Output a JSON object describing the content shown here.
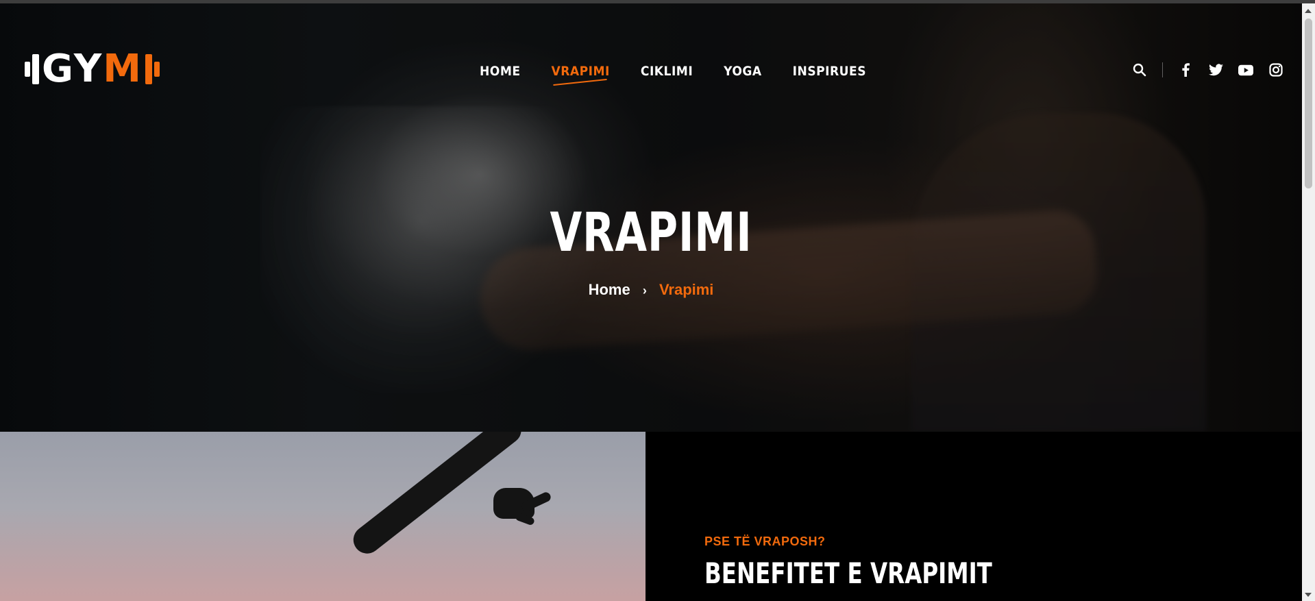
{
  "brand": {
    "logo_prefix": "GY",
    "logo_accent": "M",
    "accent_color": "#f26a0d"
  },
  "nav": {
    "items": [
      {
        "label": "HOME",
        "active": false
      },
      {
        "label": "VRAPIMI",
        "active": true
      },
      {
        "label": "CIKLIMI",
        "active": false
      },
      {
        "label": "YOGA",
        "active": false
      },
      {
        "label": "INSPIRUES",
        "active": false
      }
    ]
  },
  "header_icons": [
    "search-icon",
    "facebook-icon",
    "twitter-icon",
    "youtube-icon",
    "instagram-icon"
  ],
  "hero": {
    "title": "VRAPIMI",
    "breadcrumb_home": "Home",
    "breadcrumb_separator": "›",
    "breadcrumb_current": "Vrapimi"
  },
  "section": {
    "eyebrow": "PSE TË VRAPOSH?",
    "title": "BENEFITET E VRAPIMIT"
  }
}
